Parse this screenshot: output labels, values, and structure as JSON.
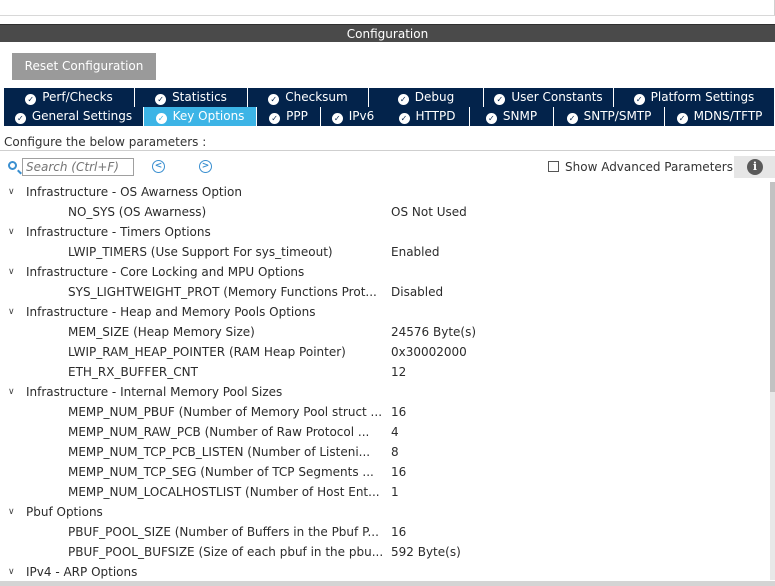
{
  "window": {
    "title": "Configuration"
  },
  "toolbar": {
    "reset_label": "Reset Configuration"
  },
  "tabs_row1": [
    {
      "label": "Perf/Checks",
      "active": false
    },
    {
      "label": "Statistics",
      "active": false
    },
    {
      "label": "Checksum",
      "active": false
    },
    {
      "label": "Debug",
      "active": false
    },
    {
      "label": "User Constants",
      "active": false
    },
    {
      "label": "Platform Settings",
      "active": false
    }
  ],
  "tabs_row2": [
    {
      "label": "General Settings",
      "active": false
    },
    {
      "label": "Key Options",
      "active": true
    },
    {
      "label": "PPP",
      "active": false
    },
    {
      "label": "IPv6",
      "active": false
    },
    {
      "label": "HTTPD",
      "active": false
    },
    {
      "label": "SNMP",
      "active": false
    },
    {
      "label": "SNTP/SMTP",
      "active": false
    },
    {
      "label": "MDNS/TFTP",
      "active": false
    }
  ],
  "configure_label": "Configure the below parameters :",
  "search": {
    "placeholder": "Search (Ctrl+F)"
  },
  "advanced": {
    "label": "Show Advanced Parameters",
    "checked": false
  },
  "icons": {
    "tab_check": "check-circle-icon",
    "search": "search-icon",
    "prev": "chevron-left-icon",
    "next": "chevron-right-icon",
    "info": "info-icon",
    "expand": "chevron-down-icon"
  },
  "colors": {
    "tab_bg": "#03234b",
    "tab_active": "#3cb4e6",
    "title_bg": "#4a4a4a",
    "reset_bg": "#9a9a9a"
  },
  "tree": [
    {
      "type": "group",
      "label": "Infrastructure - OS Awarness Option"
    },
    {
      "type": "param",
      "name": "NO_SYS (OS Awarness)",
      "value": "OS Not Used"
    },
    {
      "type": "group",
      "label": "Infrastructure - Timers Options"
    },
    {
      "type": "param",
      "name": "LWIP_TIMERS (Use Support For sys_timeout)",
      "value": "Enabled"
    },
    {
      "type": "group",
      "label": "Infrastructure - Core Locking and MPU Options"
    },
    {
      "type": "param",
      "name": "SYS_LIGHTWEIGHT_PROT (Memory Functions Prot...",
      "value": "Disabled"
    },
    {
      "type": "group",
      "label": "Infrastructure - Heap and Memory Pools Options"
    },
    {
      "type": "param",
      "name": "MEM_SIZE (Heap Memory Size)",
      "value": "24576 Byte(s)"
    },
    {
      "type": "param",
      "name": "LWIP_RAM_HEAP_POINTER (RAM Heap Pointer)",
      "value": "0x30002000"
    },
    {
      "type": "param",
      "name": "ETH_RX_BUFFER_CNT",
      "value": "12"
    },
    {
      "type": "group",
      "label": "Infrastructure - Internal Memory Pool Sizes"
    },
    {
      "type": "param",
      "name": "MEMP_NUM_PBUF (Number of Memory Pool struct ...",
      "value": "16"
    },
    {
      "type": "param",
      "name": "MEMP_NUM_RAW_PCB (Number of Raw Protocol ...",
      "value": "4"
    },
    {
      "type": "param",
      "name": "MEMP_NUM_TCP_PCB_LISTEN (Number of Listeni...",
      "value": "8"
    },
    {
      "type": "param",
      "name": "MEMP_NUM_TCP_SEG (Number of TCP Segments ...",
      "value": "16"
    },
    {
      "type": "param",
      "name": "MEMP_NUM_LOCALHOSTLIST (Number of Host Ent...",
      "value": "1"
    },
    {
      "type": "group",
      "label": "Pbuf Options"
    },
    {
      "type": "param",
      "name": "PBUF_POOL_SIZE (Number of Buffers in the Pbuf P...",
      "value": "16"
    },
    {
      "type": "param",
      "name": "PBUF_POOL_BUFSIZE (Size of each pbuf in the pbu...",
      "value": "592 Byte(s)"
    },
    {
      "type": "group",
      "label": "IPv4 - ARP Options"
    }
  ]
}
